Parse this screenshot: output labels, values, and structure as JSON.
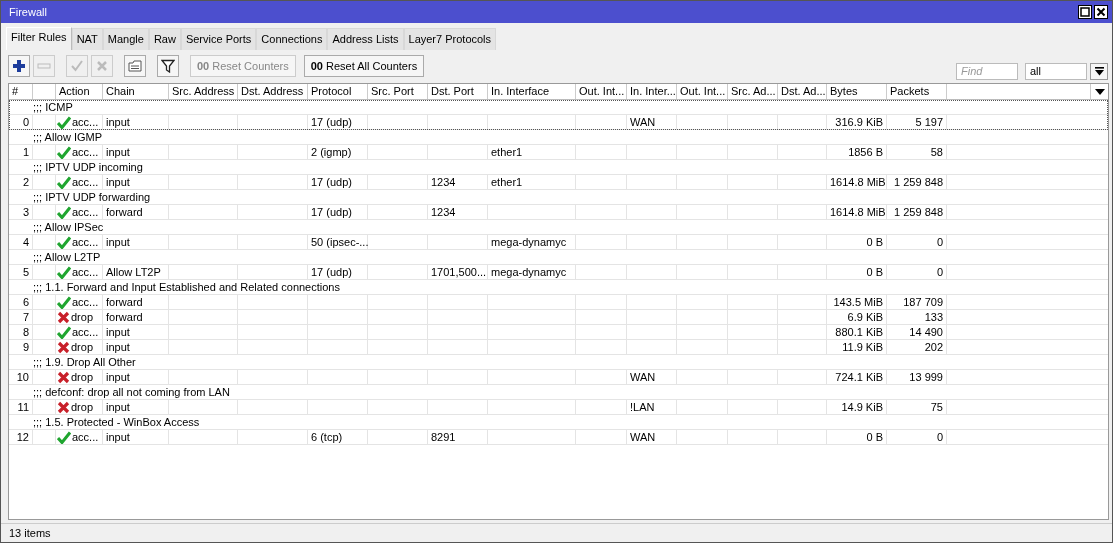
{
  "window": {
    "title": "Firewall"
  },
  "tabs": [
    {
      "label": "Filter Rules",
      "selected": true
    },
    {
      "label": "NAT",
      "selected": false
    },
    {
      "label": "Mangle",
      "selected": false
    },
    {
      "label": "Raw",
      "selected": false
    },
    {
      "label": "Service Ports",
      "selected": false
    },
    {
      "label": "Connections",
      "selected": false
    },
    {
      "label": "Address Lists",
      "selected": false
    },
    {
      "label": "Layer7 Protocols",
      "selected": false
    }
  ],
  "toolbar": {
    "buttons": [
      {
        "kind": "add",
        "disabled": false
      },
      {
        "kind": "remove",
        "disabled": true
      },
      {
        "kind": "enable",
        "disabled": true
      },
      {
        "kind": "disable",
        "disabled": true
      },
      {
        "kind": "comment",
        "disabled": false
      },
      {
        "kind": "filter",
        "disabled": false
      }
    ],
    "counter_buttons": [
      {
        "icon": "00",
        "label": "Reset Counters",
        "disabled": true
      },
      {
        "icon": "00",
        "label": "Reset All Counters",
        "disabled": false
      }
    ],
    "find": {
      "placeholder": "Find"
    },
    "scope": {
      "value": "all"
    }
  },
  "table": {
    "columns": [
      "#",
      "Action",
      "Chain",
      "Src. Address",
      "Dst. Address",
      "Protocol",
      "Src. Port",
      "Dst. Port",
      "In. Interface",
      "Out. Int...",
      "In. Inter...",
      "Out. Int...",
      "Src. Ad...",
      "Dst. Ad...",
      "Bytes",
      "Packets"
    ],
    "rows": [
      {
        "comment": ";;; ICMP",
        "number": "0",
        "kind": "accept",
        "action_label": "acc...",
        "chain": "input",
        "protocol": "17 (udp)",
        "in_interface_list": "WAN",
        "bytes": "316.9 KiB",
        "packets": "5 197",
        "selected": true
      },
      {
        "comment": ";;; Allow IGMP",
        "number": "1",
        "kind": "accept",
        "action_label": "acc...",
        "chain": "input",
        "protocol": "2 (igmp)",
        "in_interface": "ether1",
        "bytes": "1856 B",
        "packets": "58",
        "selected": false
      },
      {
        "comment": ";;; IPTV UDP incoming",
        "number": "2",
        "kind": "accept",
        "action_label": "acc...",
        "chain": "input",
        "protocol": "17 (udp)",
        "dst_port": "1234",
        "in_interface": "ether1",
        "bytes": "1614.8 MiB",
        "packets": "1 259 848",
        "selected": false
      },
      {
        "comment": ";;; IPTV UDP forwarding",
        "number": "3",
        "kind": "accept",
        "action_label": "acc...",
        "chain": "forward",
        "protocol": "17 (udp)",
        "dst_port": "1234",
        "bytes": "1614.8 MiB",
        "packets": "1 259 848",
        "selected": false
      },
      {
        "comment": ";;; Allow IPSec",
        "number": "4",
        "kind": "accept",
        "action_label": "acc...",
        "chain": "input",
        "protocol": "50 (ipsec-...",
        "in_interface": "mega-dynamyc",
        "bytes": "0 B",
        "packets": "0",
        "selected": false
      },
      {
        "comment": ";;; Allow L2TP",
        "number": "5",
        "kind": "accept",
        "action_label": "acc...",
        "chain": "Allow LT2P",
        "protocol": "17 (udp)",
        "dst_port": "1701,500...",
        "in_interface": "mega-dynamyc",
        "bytes": "0 B",
        "packets": "0",
        "selected": false
      },
      {
        "comment": ";;; 1.1. Forward and Input Established and Related connections",
        "number": "6",
        "kind": "accept",
        "action_label": "acc...",
        "chain": "forward",
        "bytes": "143.5 MiB",
        "packets": "187 709",
        "selected": false
      },
      {
        "number": "7",
        "kind": "drop",
        "action_label": "drop",
        "chain": "forward",
        "bytes": "6.9 KiB",
        "packets": "133",
        "selected": false
      },
      {
        "number": "8",
        "kind": "accept",
        "action_label": "acc...",
        "chain": "input",
        "bytes": "880.1 KiB",
        "packets": "14 490",
        "selected": false
      },
      {
        "number": "9",
        "kind": "drop",
        "action_label": "drop",
        "chain": "input",
        "bytes": "11.9 KiB",
        "packets": "202",
        "selected": false
      },
      {
        "comment": ";;; 1.9. Drop All Other",
        "number": "10",
        "kind": "drop",
        "action_label": "drop",
        "chain": "input",
        "in_interface_list": "WAN",
        "bytes": "724.1 KiB",
        "packets": "13 999",
        "selected": false
      },
      {
        "comment": ";;; defconf: drop all not coming from LAN",
        "number": "11",
        "kind": "drop",
        "action_label": "drop",
        "chain": "input",
        "in_interface_list": "!LAN",
        "bytes": "14.9 KiB",
        "packets": "75",
        "selected": false
      },
      {
        "comment": ";;; 1.5. Protected - WinBox Access",
        "number": "12",
        "kind": "accept",
        "action_label": "acc...",
        "chain": "input",
        "protocol": "6 (tcp)",
        "dst_port": "8291",
        "in_interface_list": "WAN",
        "bytes": "0 B",
        "packets": "0",
        "selected": false
      }
    ]
  },
  "status_bar": {
    "text": "13 items"
  }
}
